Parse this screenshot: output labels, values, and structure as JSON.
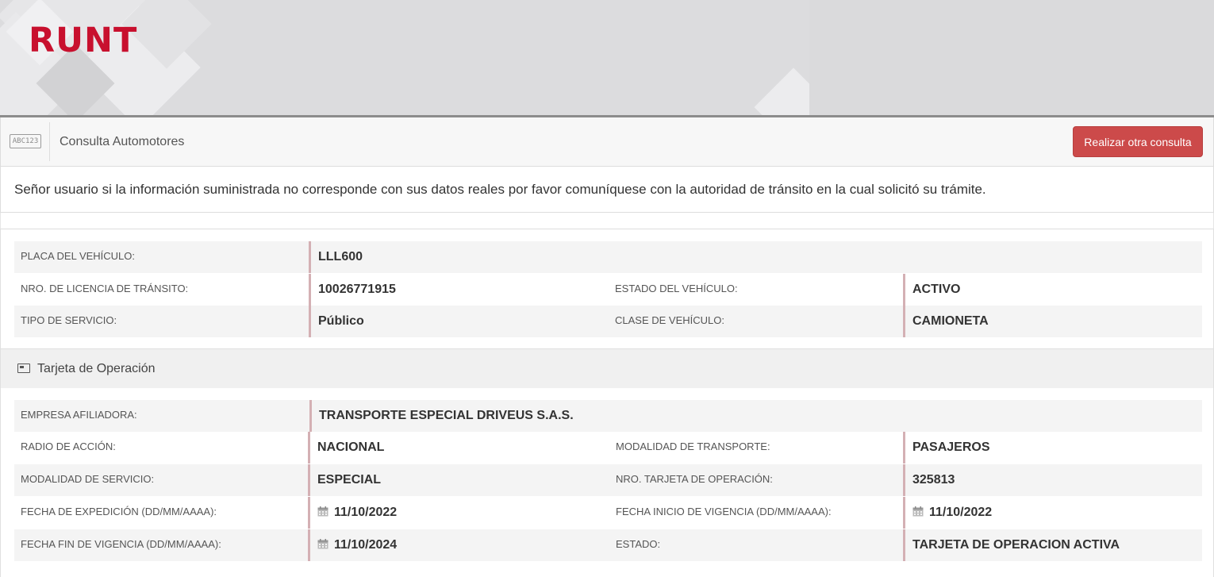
{
  "header": {
    "logo_text": "RUNT"
  },
  "toolbar": {
    "icon_text": "ABC123",
    "title": "Consulta Automotores",
    "new_query_button": "Realizar otra consulta"
  },
  "notice": {
    "text": "Señor usuario si la información suministrada no corresponde con sus datos reales por favor comuníquese con la autoridad de tránsito en la cual solicitó su trámite."
  },
  "vehicle": {
    "placa_label": "PLACA DEL VEHÍCULO:",
    "placa_value": "LLL600",
    "licencia_label": "NRO. DE LICENCIA DE TRÁNSITO:",
    "licencia_value": "10026771915",
    "estado_label": "ESTADO DEL VEHÍCULO:",
    "estado_value": "ACTIVO",
    "servicio_label": "TIPO DE SERVICIO:",
    "servicio_value": "Público",
    "clase_label": "CLASE DE VEHÍCULO:",
    "clase_value": "CAMIONETA"
  },
  "tarjeta": {
    "section_title": "Tarjeta de Operación",
    "empresa_label": "EMPRESA AFILIADORA:",
    "empresa_value": "TRANSPORTE ESPECIAL DRIVEUS S.A.S.",
    "radio_label": "RADIO DE ACCIÓN:",
    "radio_value": "NACIONAL",
    "modalidad_transporte_label": "MODALIDAD DE TRANSPORTE:",
    "modalidad_transporte_value": "PASAJEROS",
    "modalidad_servicio_label": "MODALIDAD DE SERVICIO:",
    "modalidad_servicio_value": "ESPECIAL",
    "nro_tarjeta_label": "NRO. TARJETA DE OPERACIÓN:",
    "nro_tarjeta_value": "325813",
    "fecha_expedicion_label": "FECHA DE EXPEDICIÓN (DD/MM/AAAA):",
    "fecha_expedicion_value": "11/10/2022",
    "fecha_inicio_label": "FECHA INICIO DE VIGENCIA (DD/MM/AAAA):",
    "fecha_inicio_value": "11/10/2022",
    "fecha_fin_label": "FECHA FIN DE VIGENCIA (DD/MM/AAAA):",
    "fecha_fin_value": "11/10/2024",
    "estado_label": "ESTADO:",
    "estado_value": "TARJETA DE OPERACION ACTIVA"
  },
  "colors": {
    "brand_red": "#c8102e",
    "button_red": "#cc4a4a",
    "value_border": "#d4b0b4"
  },
  "icons": {
    "toolbar_icon": "abc123-plate-icon",
    "section_icon": "id-card-icon",
    "date_icon": "calendar-icon"
  }
}
